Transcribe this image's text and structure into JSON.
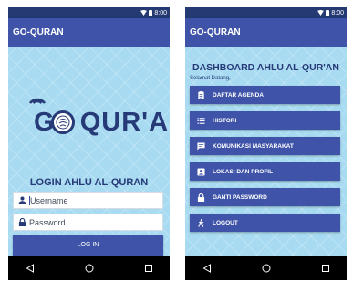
{
  "status": {
    "time": "8:00"
  },
  "app_title": "GO-QURAN",
  "login": {
    "logo_text": "G   QUR'AN",
    "title": "LOGIN AHLU AL-QURAN",
    "username_placeholder": "Username",
    "password_placeholder": "Password",
    "login_button": "LOG IN"
  },
  "dashboard": {
    "title": "DASHBOARD AHLU AL-QUR'AN",
    "welcome": "Selamat Datang,",
    "menu": [
      {
        "label": "DAFTAR AGENDA",
        "icon": "agenda-icon"
      },
      {
        "label": "HISTORI",
        "icon": "list-icon"
      },
      {
        "label": "KOMUNIKASI MASYARAKAT",
        "icon": "chat-icon"
      },
      {
        "label": "LOKASI DAN PROFIL",
        "icon": "profile-icon"
      },
      {
        "label": "GANTI PASSWORD",
        "icon": "lock-icon"
      },
      {
        "label": "LOGOUT",
        "icon": "walk-icon"
      }
    ]
  },
  "colors": {
    "status_bar": "#253a73",
    "app_bar": "#3f54a8",
    "background": "#a8dbf1",
    "title_text": "#263a78"
  }
}
